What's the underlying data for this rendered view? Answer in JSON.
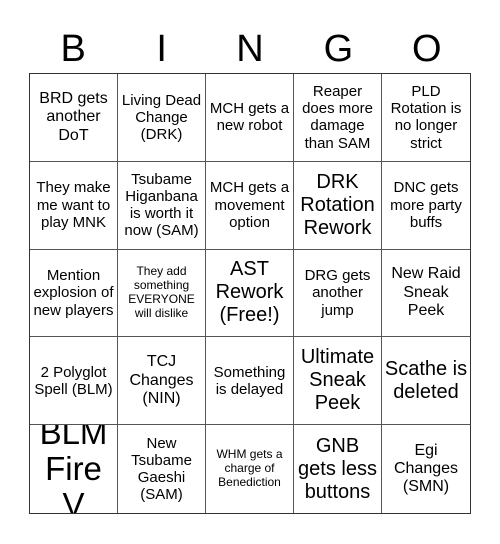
{
  "header": {
    "letters": [
      "B",
      "I",
      "N",
      "G",
      "O"
    ]
  },
  "board": {
    "cells": [
      "BRD gets another DoT",
      "Living Dead Change (DRK)",
      "MCH gets a new robot",
      "Reaper does more damage than SAM",
      "PLD Rotation is no longer strict",
      "They make me want to play MNK",
      "Tsubame Higanbana is worth it now (SAM)",
      "MCH gets a movement option",
      "DRK Rotation Rework",
      "DNC gets more party buffs",
      "Mention explosion of new players",
      "They add something EVERYONE will dislike",
      "AST Rework (Free!)",
      "DRG gets another jump",
      "New Raid Sneak Peek",
      "2 Polyglot Spell (BLM)",
      "TCJ Changes (NIN)",
      "Something is delayed",
      "Ultimate Sneak Peek",
      "Scathe is deleted",
      "BLM Fire V",
      "New Tsubame Gaeshi (SAM)",
      "WHM gets a charge of Benediction",
      "GNB gets less buttons",
      "Egi Changes (SMN)"
    ]
  }
}
